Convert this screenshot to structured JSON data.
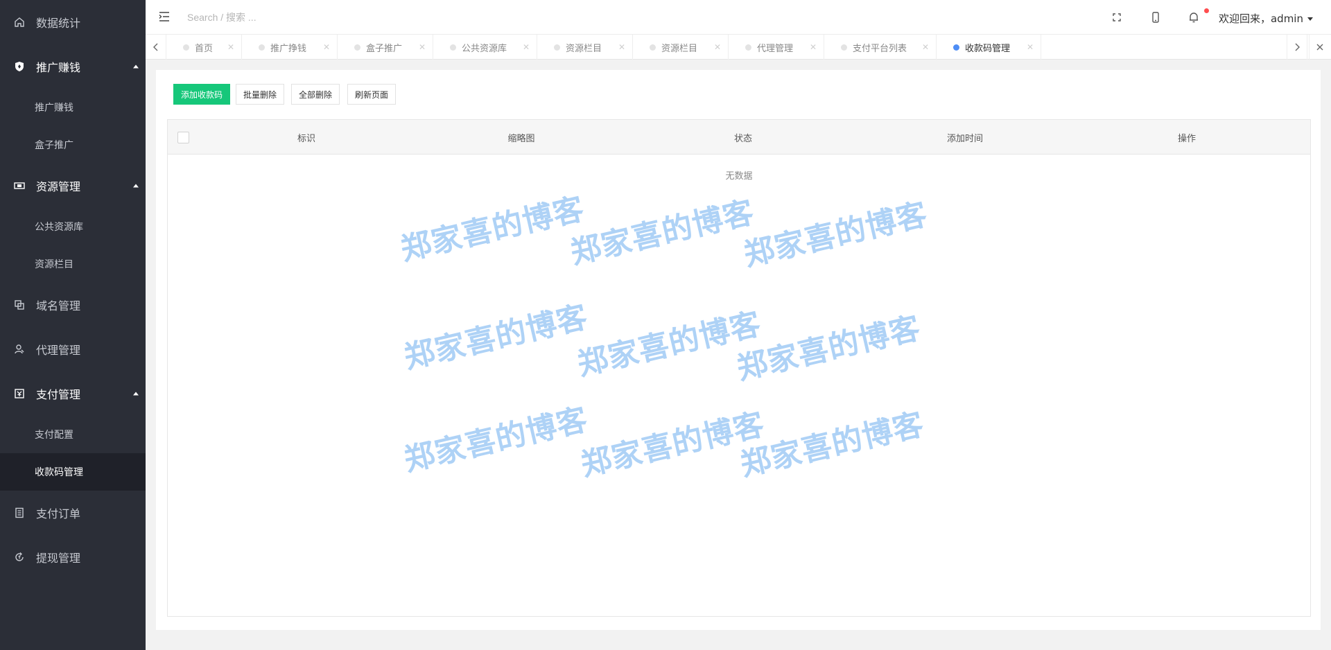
{
  "sidebar": {
    "items": [
      {
        "label": "数据统计",
        "icon": "home-icon"
      },
      {
        "label": "推广赚钱",
        "icon": "shield-icon",
        "children": [
          {
            "label": "推广赚钱"
          },
          {
            "label": "盒子推广"
          }
        ]
      },
      {
        "label": "资源管理",
        "icon": "resource-icon",
        "children": [
          {
            "label": "公共资源库"
          },
          {
            "label": "资源栏目"
          }
        ]
      },
      {
        "label": "域名管理",
        "icon": "domain-icon"
      },
      {
        "label": "代理管理",
        "icon": "agent-icon"
      },
      {
        "label": "支付管理",
        "icon": "payment-icon",
        "children": [
          {
            "label": "支付配置"
          },
          {
            "label": "收款码管理"
          }
        ]
      },
      {
        "label": "支付订单",
        "icon": "order-icon"
      },
      {
        "label": "提现管理",
        "icon": "withdraw-icon"
      }
    ]
  },
  "header": {
    "search_placeholder": "Search / 搜索 ...",
    "welcome": "欢迎回来，admin"
  },
  "tabs": [
    {
      "label": "首页"
    },
    {
      "label": "推广挣钱"
    },
    {
      "label": "盒子推广"
    },
    {
      "label": "公共资源库"
    },
    {
      "label": "资源栏目"
    },
    {
      "label": "资源栏目"
    },
    {
      "label": "代理管理"
    },
    {
      "label": "支付平台列表"
    },
    {
      "label": "收款码管理",
      "active": true
    }
  ],
  "toolbar": {
    "add_label": "添加收款码",
    "batch_delete_label": "批量删除",
    "delete_all_label": "全部删除",
    "refresh_label": "刷新页面"
  },
  "table": {
    "columns": [
      "标识",
      "缩略图",
      "状态",
      "添加时间",
      "操作"
    ],
    "empty_text": "无数据"
  },
  "watermark": "郑家喜的博客",
  "colors": {
    "sidebar_bg": "#2b2e37",
    "primary": "#16c77a",
    "active_tab_dot": "#4e8df5",
    "notification_dot": "#ff4d4f"
  }
}
